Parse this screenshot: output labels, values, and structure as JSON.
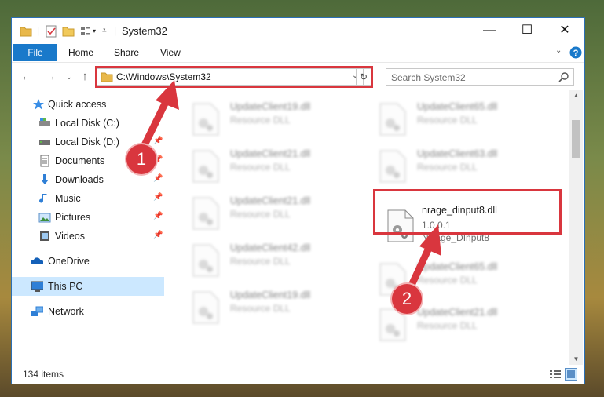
{
  "window": {
    "title": "System32",
    "controls": {
      "minimize": "—",
      "maximize": "☐",
      "close": "✕"
    }
  },
  "ribbon": {
    "tabs": [
      "File",
      "Home",
      "Share",
      "View"
    ]
  },
  "nav": {
    "address": "C:\\Windows\\System32",
    "search_placeholder": "Search System32"
  },
  "sidebar": {
    "items": [
      {
        "label": "Quick access",
        "icon": "star-icon",
        "pinned": false
      },
      {
        "label": "Local Disk (C:)",
        "icon": "drive-icon",
        "pinned": false
      },
      {
        "label": "Local Disk (D:)",
        "icon": "drive-icon",
        "pinned": true
      },
      {
        "label": "Documents",
        "icon": "documents-icon",
        "pinned": true
      },
      {
        "label": "Downloads",
        "icon": "downloads-icon",
        "pinned": true
      },
      {
        "label": "Music",
        "icon": "music-icon",
        "pinned": true
      },
      {
        "label": "Pictures",
        "icon": "pictures-icon",
        "pinned": true
      },
      {
        "label": "Videos",
        "icon": "videos-icon",
        "pinned": true
      },
      {
        "label": "OneDrive",
        "icon": "onedrive-icon",
        "pinned": false
      },
      {
        "label": "This PC",
        "icon": "this-pc-icon",
        "pinned": false
      },
      {
        "label": "Network",
        "icon": "network-icon",
        "pinned": false
      }
    ]
  },
  "files": [
    {
      "name": "UpdateClient19.dll",
      "line2": "Resource DLL",
      "line3": "",
      "blurred": true
    },
    {
      "name": "UpdateClient65.dll",
      "line2": "Resource DLL",
      "line3": "",
      "blurred": true
    },
    {
      "name": "UpdateClient21.dll",
      "line2": "Resource DLL",
      "line3": "",
      "blurred": true
    },
    {
      "name": "UpdateClient63.dll",
      "line2": "Resource DLL",
      "line3": "",
      "blurred": true
    },
    {
      "name": "UpdateClient21.dll",
      "line2": "Resource DLL",
      "line3": "",
      "blurred": true
    },
    {
      "name": "nrage_dinput8.dll",
      "line2": "1.0.0.1",
      "line3": "NRage_DInput8",
      "blurred": false
    },
    {
      "name": "UpdateClient42.dll",
      "line2": "Resource DLL",
      "line3": "",
      "blurred": true
    },
    {
      "name": "UpdateClient65.dll",
      "line2": "Resource DLL",
      "line3": "",
      "blurred": true
    },
    {
      "name": "UpdateClient19.dll",
      "line2": "Resource DLL",
      "line3": "",
      "blurred": true
    },
    {
      "name": "UpdateClient21.dll",
      "line2": "Resource DLL",
      "line3": "",
      "blurred": true
    }
  ],
  "status": {
    "item_count": "134 items"
  },
  "callouts": {
    "step1": "1",
    "step2": "2"
  },
  "colors": {
    "accent": "#1979ca",
    "highlight": "#d9363e",
    "selected": "#cce8ff"
  }
}
